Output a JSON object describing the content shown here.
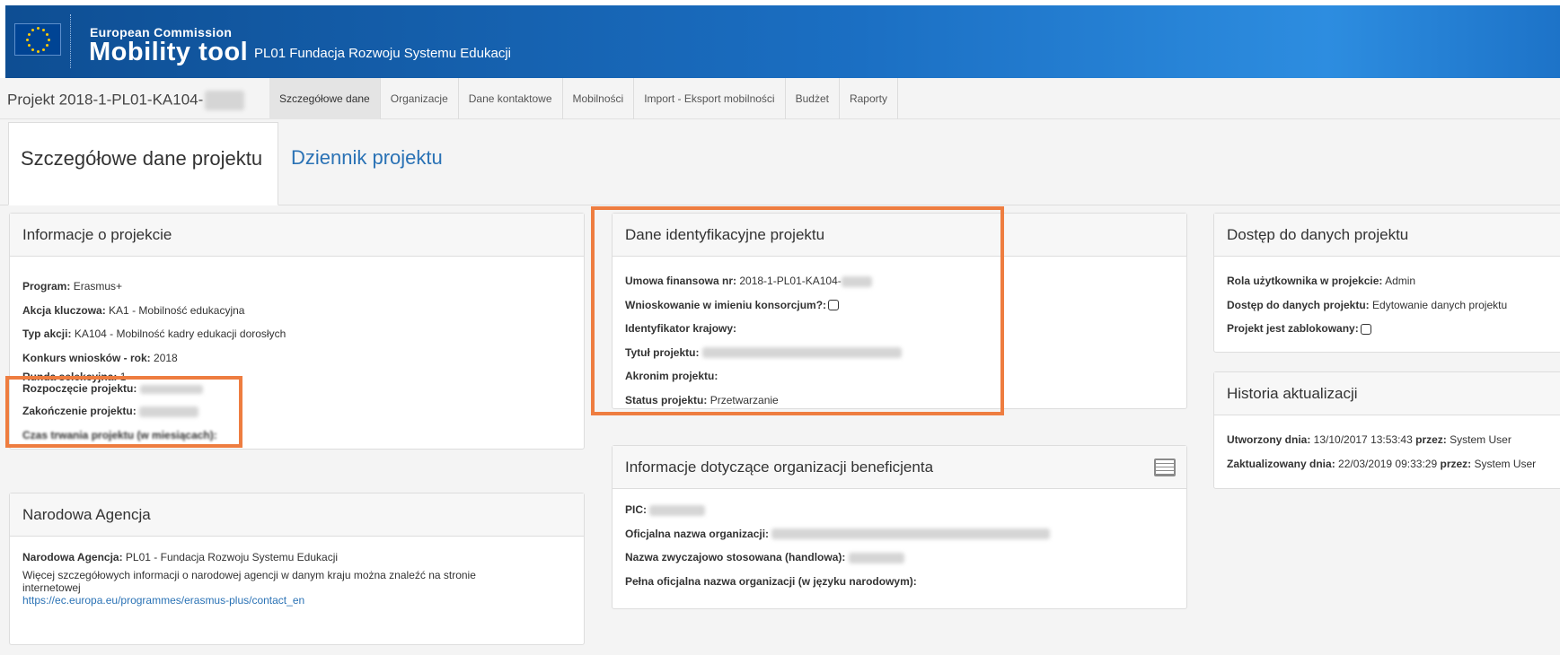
{
  "header": {
    "ec_label": "European Commission",
    "app_name": "Mobility tool",
    "org_name": "PL01 Fundacja Rozwoju Systemu Edukacji"
  },
  "nav": {
    "project_id": "Projekt 2018-1-PL01-KA104-",
    "items": [
      "Szczegółowe dane",
      "Organizacje",
      "Dane kontaktowe",
      "Mobilności",
      "Import - Eksport mobilności",
      "Budżet",
      "Raporty"
    ],
    "active": "Szczegółowe dane"
  },
  "tabs": {
    "active": "Szczegółowe dane projektu",
    "inactive": "Dziennik projektu"
  },
  "info_panel": {
    "title": "Informacje o projekcie",
    "rows": [
      {
        "label": "Program:",
        "value": "Erasmus+"
      },
      {
        "label": "Akcja kluczowa:",
        "value": "KA1 - Mobilność edukacyjna"
      },
      {
        "label": "Typ akcji:",
        "value": "KA104 - Mobilność kadry edukacji dorosłych"
      },
      {
        "label": "Konkurs wniosków - rok:",
        "value": "2018"
      },
      {
        "label": "Runda selekcyjna:",
        "value": "1"
      },
      {
        "label": "Rozpoczęcie projektu:",
        "value": ""
      },
      {
        "label": "Zakończenie projektu:",
        "value": ""
      },
      {
        "label": "Czas trwania projektu (w miesiącach):",
        "value": ""
      }
    ]
  },
  "agency_panel": {
    "title": "Narodowa Agencja",
    "label": "Narodowa Agencja:",
    "value": "PL01 - Fundacja Rozwoju Systemu Edukacji",
    "note": "Więcej szczegółowych informacji o narodowej agencji w danym kraju można znaleźć na stronie internetowej",
    "link": "https://ec.europa.eu/programmes/erasmus-plus/contact_en"
  },
  "ident_panel": {
    "title": "Dane identyfikacyjne projektu",
    "rows": [
      {
        "label": "Umowa finansowa nr:",
        "value": "2018-1-PL01-KA104-"
      },
      {
        "label": "Wnioskowanie w imieniu konsorcjum?:",
        "value": ""
      },
      {
        "label": "Identyfikator krajowy:",
        "value": ""
      },
      {
        "label": "Tytuł projektu:",
        "value": ""
      },
      {
        "label": "Akronim projektu:",
        "value": ""
      },
      {
        "label": "Status projektu:",
        "value": "Przetwarzanie"
      }
    ]
  },
  "beneficiary_panel": {
    "title": "Informacje dotyczące organizacji beneficjenta",
    "rows": [
      {
        "label": "PIC:",
        "value": ""
      },
      {
        "label": "Oficjalna nazwa organizacji:",
        "value": ""
      },
      {
        "label": "Nazwa zwyczajowo stosowana (handlowa):",
        "value": ""
      },
      {
        "label": "Pełna oficjalna nazwa organizacji (w języku narodowym):",
        "value": ""
      }
    ]
  },
  "access_panel": {
    "title": "Dostęp do danych projektu",
    "rows": [
      {
        "label": "Rola użytkownika w projekcie:",
        "value": "Admin"
      },
      {
        "label": "Dostęp do danych projektu:",
        "value": "Edytowanie danych projektu"
      },
      {
        "label": "Projekt jest zablokowany:",
        "value": ""
      }
    ]
  },
  "history_panel": {
    "title": "Historia aktualizacji",
    "created_label": "Utworzony dnia:",
    "created_value": "13/10/2017 13:53:43",
    "created_by_label": "przez:",
    "created_by": "System User",
    "updated_label": "Zaktualizowany dnia:",
    "updated_value": "22/03/2019 09:33:29",
    "updated_by_label": "przez:",
    "updated_by": "System User"
  },
  "colors": {
    "header_blue": "#1b6fc3",
    "link_blue": "#2a72b5",
    "highlight_orange": "#ee7d40"
  },
  "icons": [
    "eu-flag-icon",
    "table-icon",
    "checkbox-icon"
  ]
}
